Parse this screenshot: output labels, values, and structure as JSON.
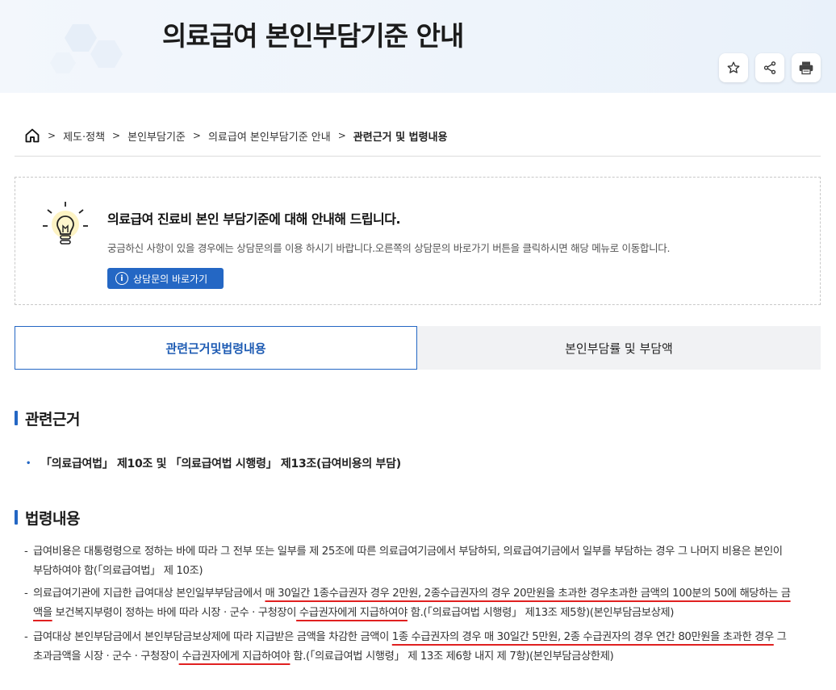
{
  "header": {
    "title": "의료급여 본인부담기준 안내",
    "actions": [
      {
        "icon": "star-icon",
        "name": "bookmark-button"
      },
      {
        "icon": "share-icon",
        "name": "share-button"
      },
      {
        "icon": "print-icon",
        "name": "print-button"
      }
    ]
  },
  "breadcrumb": {
    "home_icon": "home-icon",
    "items": [
      "제도·정책",
      "본인부담기준",
      "의료급여 본인부담기준 안내",
      "관련근거 및 법령내용"
    ]
  },
  "notice": {
    "icon": "lightbulb-icon",
    "title": "의료급여 진료비 본인 부담기준에 대해 안내해 드립니다.",
    "description": "궁금하신 사항이 있을 경우에는 상담문의를 이용 하시기 바랍니다.오른쪽의 상담문의 바로가기 버튼을 클릭하시면 해당 메뉴로 이동합니다.",
    "button_label": "상담문의 바로가기",
    "button_icon": "info-icon"
  },
  "tabs": [
    {
      "label": "관련근거및법령내용",
      "active": true
    },
    {
      "label": "본인부담률 및 부담액",
      "active": false
    }
  ],
  "sections": {
    "basis": {
      "title": "관련근거",
      "item": "「의료급여법」 제10조 및 「의료급여법 시행령」 제13조(급여비용의 부담)"
    },
    "law": {
      "title": "법령내용",
      "paragraphs": [
        {
          "dash": "-",
          "line1": "급여비용은 대통령령으로 정하는 바에 따라 그 전부 또는 일부를 제 25조에 따른 의료급여기금에서 부담하되, 의료급여기금에서 일부를 부담하는 경우 그 나머지 비용은 본인이",
          "line2": "부담하여야 함(「의료급여법」 제 10조)"
        },
        {
          "dash": "-",
          "l1a": "의료급여기관에 지급한 급여대상 본인일부부담금에서 ",
          "l1b": "매 30일간 1종수급권자 경우 2만원, 2종수급권자의 경우 20만원을 초과한 경우초과한 금액의 100분의 50에 해당하는 금",
          "l2a": "액을",
          "l2b": " 보건복지부령이 정하는 바에 따라 시장 · 군수 · 구청장이",
          "l2c": " 수급권자에게 지급하여야",
          "l2d": " 함.(「의료급여법 시행령」 제13조 제5항)(본인부담금보상제)"
        },
        {
          "dash": "-",
          "l1a": "급여대상 본인부담금에서 본인부담금보상제에 따라 지급받은 금액을 차감한 금액이 ",
          "l1b": "1종 수급권자의 경우 매 30일간 5만원, 2종 수급권자의 경우 연간 80만원을 초과한 경우",
          "l1c": " 그",
          "l2a": "초과금액을 시장 · 군수 · 구청장이",
          "l2b": " 수급권자에게 지급하여야",
          "l2c": " 함.(「의료급여법 시행령」 제 13조 제6항 내지 제 7항)(본인부담금상한제)"
        }
      ]
    }
  },
  "colors": {
    "accent": "#2467c4",
    "underline": "#e02020",
    "tab_inactive_bg": "#f1f2f4"
  }
}
